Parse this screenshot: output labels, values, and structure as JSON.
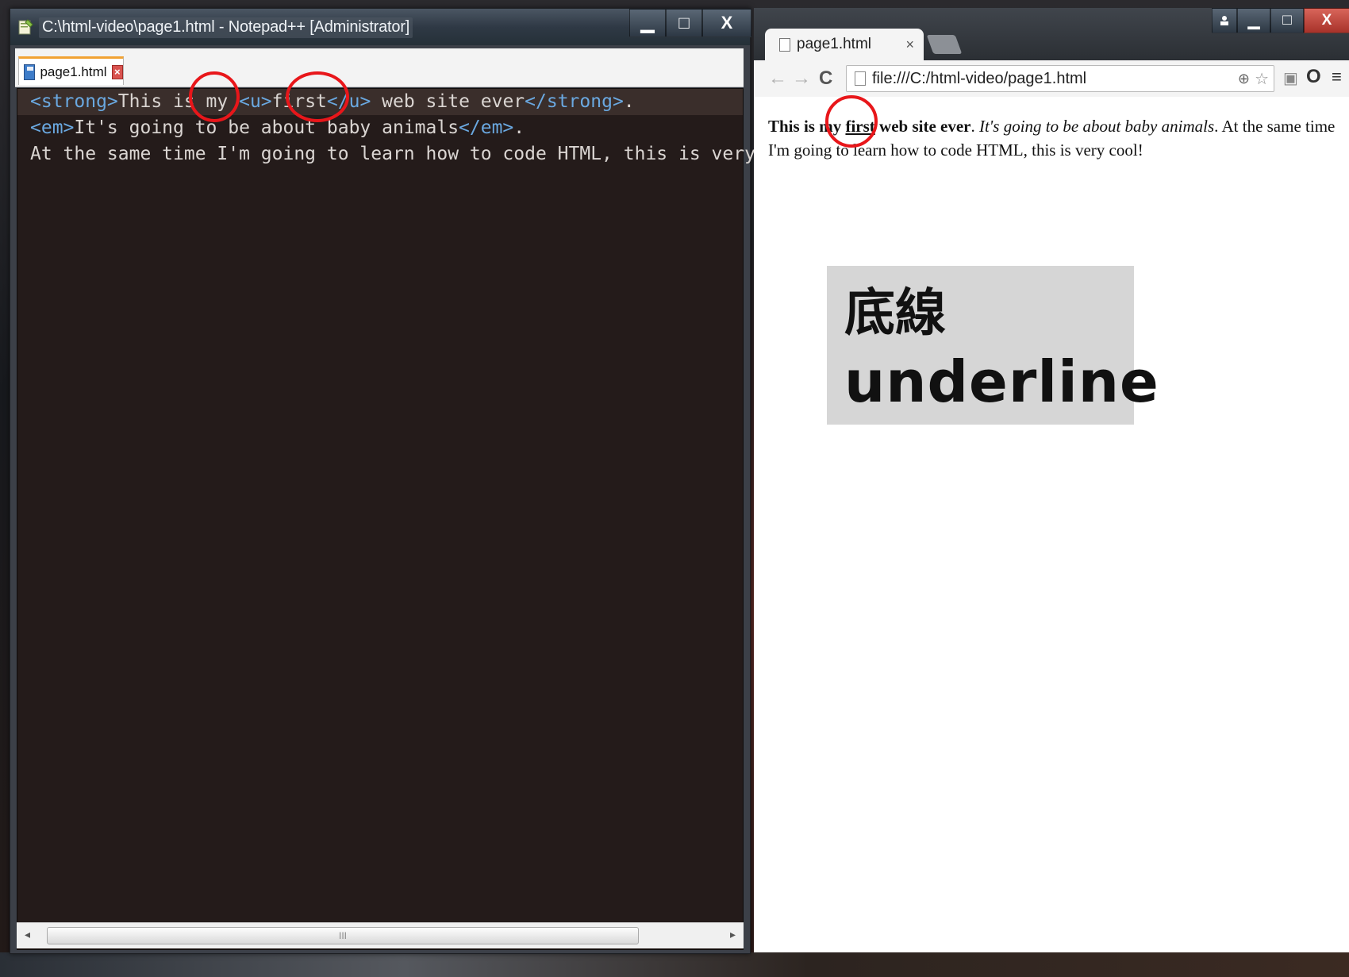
{
  "notepad": {
    "title": "C:\\html-video\\page1.html - Notepad++ [Administrator]",
    "tab_label": "page1.html",
    "tab_close_glyph": "×",
    "buttons": {
      "minimize": "▁",
      "maximize": "□",
      "close": "X"
    },
    "code_lines": [
      [
        {
          "t": "<strong>",
          "k": "tag"
        },
        {
          "t": "This is my ",
          "k": "txt"
        },
        {
          "t": "<u>",
          "k": "tag"
        },
        {
          "t": "first",
          "k": "txt"
        },
        {
          "t": "</u>",
          "k": "tag"
        },
        {
          "t": " web site ever",
          "k": "txt"
        },
        {
          "t": "</strong>",
          "k": "tag"
        },
        {
          "t": ".",
          "k": "txt"
        }
      ],
      [
        {
          "t": "<em>",
          "k": "tag"
        },
        {
          "t": "It's going to be about baby animals",
          "k": "txt"
        },
        {
          "t": "</em>",
          "k": "tag"
        },
        {
          "t": ".",
          "k": "txt"
        }
      ],
      [
        {
          "t": "At the same time I'm going to learn how to code HTML, this is very cool!",
          "k": "txt"
        }
      ]
    ],
    "scroll_left": "◂",
    "scroll_right": "▸",
    "scroll_grip": "III"
  },
  "browser": {
    "tab_title": "page1.html",
    "tab_close": "×",
    "url": "file:///C:/html-video/page1.html",
    "nav": {
      "back": "←",
      "forward": "→",
      "reload": "C"
    },
    "buttons": {
      "minimize": "▁",
      "maximize": "□",
      "close": "X"
    },
    "page": {
      "strong_before": "This is my ",
      "underlined": "first",
      "strong_after": " web site ever",
      "dot1": ". ",
      "em": "It's going to be about baby animals",
      "rest": ". At the same time I'm going to learn how to code HTML, this is very cool!"
    }
  },
  "callout": {
    "chinese": "底線",
    "english": "underline"
  },
  "colors": {
    "highlight_ring": "#e8161a",
    "editor_bg": "#241b1a",
    "tag_color": "#6aa8e0"
  }
}
